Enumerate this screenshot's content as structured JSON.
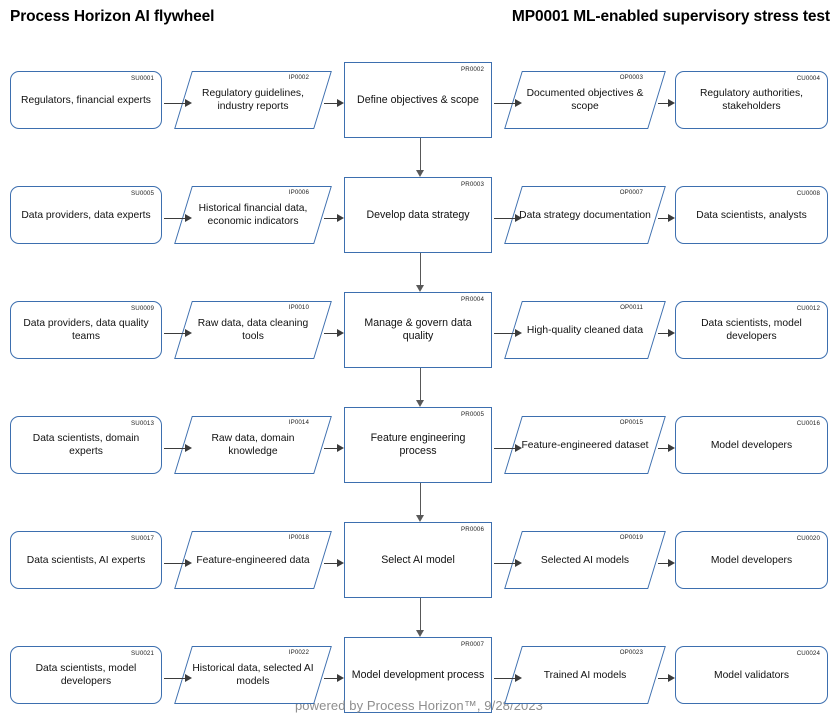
{
  "header": {
    "title_left": "Process Horizon AI flywheel",
    "title_right": "MP0001 ML-enabled supervisory stress test"
  },
  "theme": {
    "shape_border": "#3D6FAF",
    "shape_fill": "#FFFFFF",
    "arrow_horizontal": "#3B3B3B",
    "arrow_vertical": "#585858",
    "footer_text": "#8E8E8E",
    "title_text": "#000000"
  },
  "columns": [
    {
      "key": "supplier",
      "shape": "rounded-rectangle"
    },
    {
      "key": "input",
      "shape": "parallelogram"
    },
    {
      "key": "process",
      "shape": "rectangle"
    },
    {
      "key": "output",
      "shape": "parallelogram"
    },
    {
      "key": "customer",
      "shape": "rounded-rectangle"
    }
  ],
  "rows": [
    {
      "supplier": {
        "id": "SU0001",
        "label": "Regulators, financial experts"
      },
      "input": {
        "id": "IP0002",
        "label": "Regulatory guidelines, industry reports"
      },
      "process": {
        "id": "PR0002",
        "label": "Define objectives & scope"
      },
      "output": {
        "id": "OP0003",
        "label": "Documented objectives & scope"
      },
      "customer": {
        "id": "CU0004",
        "label": "Regulatory authorities, stakeholders"
      }
    },
    {
      "supplier": {
        "id": "SU0005",
        "label": "Data providers, data experts"
      },
      "input": {
        "id": "IP0006",
        "label": "Historical financial data, economic indicators"
      },
      "process": {
        "id": "PR0003",
        "label": "Develop data strategy"
      },
      "output": {
        "id": "OP0007",
        "label": "Data strategy documentation"
      },
      "customer": {
        "id": "CU0008",
        "label": "Data scientists, analysts"
      }
    },
    {
      "supplier": {
        "id": "SU0009",
        "label": "Data providers, data quality teams"
      },
      "input": {
        "id": "IP0010",
        "label": "Raw data, data cleaning tools"
      },
      "process": {
        "id": "PR0004",
        "label": "Manage & govern data quality"
      },
      "output": {
        "id": "OP0011",
        "label": "High-quality cleaned data"
      },
      "customer": {
        "id": "CU0012",
        "label": "Data scientists, model developers"
      }
    },
    {
      "supplier": {
        "id": "SU0013",
        "label": "Data scientists, domain experts"
      },
      "input": {
        "id": "IP0014",
        "label": "Raw data, domain knowledge"
      },
      "process": {
        "id": "PR0005",
        "label": "Feature engineering process"
      },
      "output": {
        "id": "OP0015",
        "label": "Feature-engineered dataset"
      },
      "customer": {
        "id": "CU0016",
        "label": "Model developers"
      }
    },
    {
      "supplier": {
        "id": "SU0017",
        "label": "Data scientists, AI experts"
      },
      "input": {
        "id": "IP0018",
        "label": "Feature-engineered data"
      },
      "process": {
        "id": "PR0006",
        "label": "Select AI model"
      },
      "output": {
        "id": "OP0019",
        "label": "Selected AI models"
      },
      "customer": {
        "id": "CU0020",
        "label": "Model developers"
      }
    },
    {
      "supplier": {
        "id": "SU0021",
        "label": "Data scientists, model developers"
      },
      "input": {
        "id": "IP0022",
        "label": "Historical data, selected AI models"
      },
      "process": {
        "id": "PR0007",
        "label": "Model development process"
      },
      "output": {
        "id": "OP0023",
        "label": "Trained AI models"
      },
      "customer": {
        "id": "CU0024",
        "label": "Model validators"
      }
    }
  ],
  "footer": {
    "text": "powered by Process Horizon™, 9/28/2023"
  }
}
